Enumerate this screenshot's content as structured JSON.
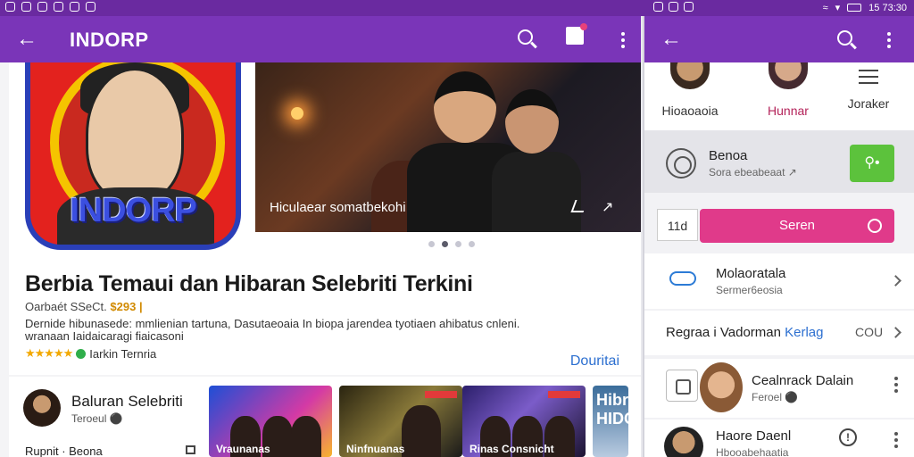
{
  "statusbar": {
    "time": "15 73:30"
  },
  "left": {
    "appbar": {
      "title": "INDORP",
      "icons": [
        "back-arrow-icon",
        "search-icon",
        "edit-icon",
        "more-vert-icon"
      ]
    },
    "app_icon": {
      "brand": "INDORP"
    },
    "banner": {
      "caption": "Hiculaear somatbekohi",
      "pager_total": 4,
      "pager_active": 1
    },
    "info": {
      "title": "Berbia Temaui dan Hibaran Selebriti Terkini",
      "meta_prefix": "Oarbaét SSeCt.",
      "meta_value": "$293 |",
      "desc": "Dernide hibunasede: mmlienian tartuna, Dasutaeoaia In biopa jarendea tyotiaen ahibatus cnleni. wranaan Iaidaicaragi fiaicasoni",
      "stars": "★★★★★",
      "rating_label": "Iarkin Ternria",
      "link": "Douritai"
    },
    "section": {
      "title": "Baluran Selebriti",
      "subtitle": "Teroeul ⚫",
      "footer": "Rupnit · Beona",
      "thumbs": [
        {
          "label": "Vraunanas"
        },
        {
          "label": "Ninfnuanas"
        },
        {
          "label": "Rinas Consnicht"
        },
        {
          "label": "Hibr HIDO"
        }
      ]
    }
  },
  "right": {
    "appbar": {
      "icons": [
        "back-arrow-icon",
        "search-icon",
        "more-vert-icon"
      ]
    },
    "categories": [
      {
        "label": "Hioaoaoia"
      },
      {
        "label": "Hunnar"
      },
      {
        "label": "Joraker"
      }
    ],
    "row1": {
      "title": "Benoa",
      "subtitle": "Sora ebeabeaat ↗"
    },
    "row2": {
      "count": "11d",
      "button": "Seren"
    },
    "row3": {
      "title": "Molaoratala",
      "subtitle": "Sermer6eosia"
    },
    "row4": {
      "title_main": "Regraa i Vadorman ",
      "title_accent": "Kerlag",
      "count": "COU"
    },
    "row5": {
      "title": "Cealnrack Dalain",
      "subtitle": "Feroel ⚫"
    },
    "row6": {
      "title": "Haore Daenl",
      "subtitle": "Hbooabehaatia"
    }
  },
  "colors": {
    "appbar": "#7a35b8",
    "statusbar": "#6a2aa0",
    "accent_pink": "#e03a8a",
    "accent_green": "#5cc23c",
    "link_blue": "#2c6fd0"
  }
}
